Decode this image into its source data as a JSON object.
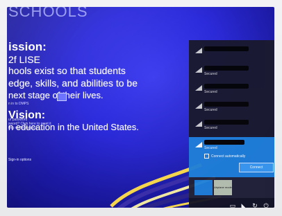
{
  "background": {
    "title": "SCHOOLS",
    "mission_heading": "ission:",
    "mission_lines": [
      "2f LISE",
      "hools exist so that students",
      "edge, skills, and abilities to be",
      "next stage of their lives."
    ],
    "signin_help": [
      "n in to DMPS",
      "ur password",
      "sword? Click here to reset it",
      "ting myBrowsword."
    ],
    "vision_heading": "Vision:",
    "vision_line": "n education in the United States.",
    "signin_options": "Sign-in options"
  },
  "network_flyout": {
    "networks": [
      {
        "status": ""
      },
      {
        "status": "Secured"
      },
      {
        "status": "Secured"
      },
      {
        "status": "Secured"
      },
      {
        "status": "Secured"
      }
    ],
    "selected": {
      "status": "Secured",
      "auto_connect_label": "Connect automatically",
      "connect_label": "Connect"
    },
    "tiles": [
      {
        "label": ""
      },
      {
        "label": "Airplane mode"
      }
    ]
  },
  "taskbar": {
    "icons": [
      "network-icon",
      "wifi-icon",
      "accessibility-icon",
      "power-icon"
    ]
  }
}
